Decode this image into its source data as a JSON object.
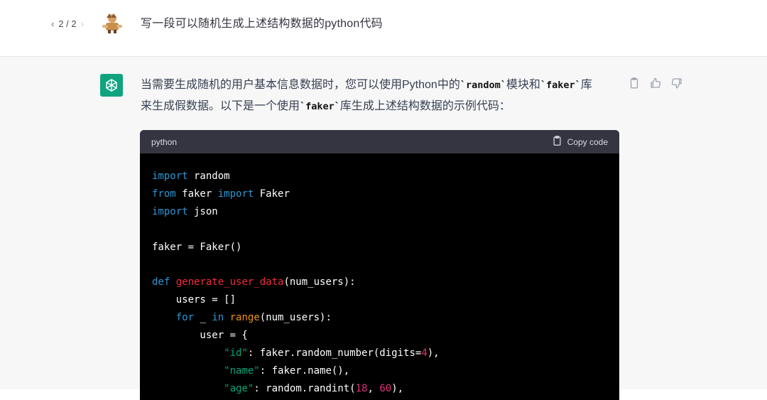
{
  "user_message": {
    "pager": {
      "prev": "‹",
      "position": "2 / 2",
      "next": "›"
    },
    "text": "写一段可以随机生成上述结构数据的python代码"
  },
  "assistant_message": {
    "line1_pre": "当需要生成随机的用户基本信息数据时，您可以使用Python中的",
    "code_random": "`random`",
    "line1_mid": "模块和",
    "code_faker1": "`faker`",
    "line1_end": "库",
    "line2_pre": "来生成假数据。以下是一个使用",
    "code_faker2": "`faker`",
    "line2_end": "库生成上述结构数据的示例代码："
  },
  "actions": [
    "clipboard-icon",
    "thumbs-up-icon",
    "thumbs-down-icon"
  ],
  "code_block": {
    "language": "python",
    "copy_label": "Copy code",
    "lines": [
      [
        {
          "t": "import",
          "c": "kw"
        },
        {
          "t": " random",
          "c": ""
        }
      ],
      [
        {
          "t": "from",
          "c": "kw"
        },
        {
          "t": " faker ",
          "c": ""
        },
        {
          "t": "import",
          "c": "kw"
        },
        {
          "t": " Faker",
          "c": ""
        }
      ],
      [
        {
          "t": "import",
          "c": "kw"
        },
        {
          "t": " json",
          "c": ""
        }
      ],
      [],
      [
        {
          "t": "faker = Faker()",
          "c": ""
        }
      ],
      [],
      [
        {
          "t": "def",
          "c": "kw"
        },
        {
          "t": " ",
          "c": ""
        },
        {
          "t": "generate_user_data",
          "c": "fn"
        },
        {
          "t": "(num_users):",
          "c": ""
        }
      ],
      [
        {
          "t": "    users = []",
          "c": ""
        }
      ],
      [
        {
          "t": "    ",
          "c": ""
        },
        {
          "t": "for",
          "c": "kw"
        },
        {
          "t": " _ ",
          "c": ""
        },
        {
          "t": "in",
          "c": "kw"
        },
        {
          "t": " ",
          "c": ""
        },
        {
          "t": "range",
          "c": "bi"
        },
        {
          "t": "(num_users):",
          "c": ""
        }
      ],
      [
        {
          "t": "        user = {",
          "c": ""
        }
      ],
      [
        {
          "t": "            ",
          "c": ""
        },
        {
          "t": "\"id\"",
          "c": "str"
        },
        {
          "t": ": faker.random_number(digits=",
          "c": ""
        },
        {
          "t": "4",
          "c": "num"
        },
        {
          "t": "),",
          "c": ""
        }
      ],
      [
        {
          "t": "            ",
          "c": ""
        },
        {
          "t": "\"name\"",
          "c": "str"
        },
        {
          "t": ": faker.name(),",
          "c": ""
        }
      ],
      [
        {
          "t": "            ",
          "c": ""
        },
        {
          "t": "\"age\"",
          "c": "str"
        },
        {
          "t": ": random.randint(",
          "c": ""
        },
        {
          "t": "18",
          "c": "num"
        },
        {
          "t": ", ",
          "c": ""
        },
        {
          "t": "60",
          "c": "num"
        },
        {
          "t": "),",
          "c": ""
        }
      ]
    ]
  },
  "colors": {
    "accent": "#10a37f",
    "code_keyword": "#2e95d3",
    "code_function": "#f22c3d",
    "code_builtin": "#e9950c",
    "code_string": "#00a67d",
    "code_number": "#df3079"
  }
}
